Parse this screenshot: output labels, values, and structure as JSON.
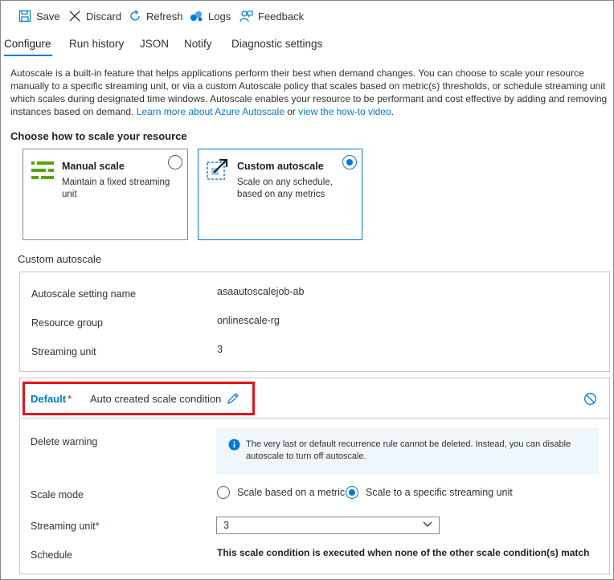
{
  "toolbar": {
    "save": "Save",
    "discard": "Discard",
    "refresh": "Refresh",
    "logs": "Logs",
    "feedback": "Feedback"
  },
  "tabs": [
    {
      "label": "Configure",
      "active": true
    },
    {
      "label": "Run history",
      "active": false
    },
    {
      "label": "JSON",
      "active": false
    },
    {
      "label": "Notify",
      "active": false
    },
    {
      "label": "Diagnostic settings",
      "active": false
    }
  ],
  "intro": {
    "text": "Autoscale is a built-in feature that helps applications perform their best when demand changes. You can choose to scale your resource manually to a specific streaming unit, or via a custom Autoscale policy that scales based on metric(s) thresholds, or schedule streaming unit which scales during designated time windows. Autoscale enables your resource to be performant and cost effective by adding and removing instances based on demand. ",
    "link1": "Learn more about Azure Autoscale",
    "or": " or ",
    "link2": "view the how-to video",
    "end": "."
  },
  "scale_choice": {
    "heading": "Choose how to scale your resource",
    "manual": {
      "title": "Manual scale",
      "desc": "Maintain a fixed streaming unit",
      "selected": false
    },
    "custom": {
      "title": "Custom autoscale",
      "desc": "Scale on any schedule, based on any metrics",
      "selected": true
    }
  },
  "custom_autoscale": {
    "label": "Custom autoscale",
    "setting_name_label": "Autoscale setting name",
    "setting_name_value": "asaautoscalejob-ab",
    "resource_group_label": "Resource group",
    "resource_group_value": "onlinescale-rg",
    "streaming_unit_label": "Streaming unit",
    "streaming_unit_value": "3"
  },
  "condition": {
    "name": "Default",
    "required_mark": "*",
    "description": "Auto created scale condition",
    "delete_warning_label": "Delete warning",
    "delete_warning_text": "The very last or default recurrence rule cannot be deleted. Instead, you can disable autoscale to turn off autoscale.",
    "scale_mode_label": "Scale mode",
    "scale_mode_options": [
      {
        "label": "Scale based on a metric",
        "selected": false
      },
      {
        "label": "Scale to a specific streaming unit",
        "selected": true
      }
    ],
    "streaming_unit_label": "Streaming unit",
    "streaming_unit_required": "*",
    "streaming_unit_value": "3",
    "schedule_label": "Schedule",
    "schedule_text": "This scale condition is executed when none of the other scale condition(s) match"
  },
  "colors": {
    "accent": "#0078d4",
    "highlight": "#e3141b",
    "manual_icon": "#57a300",
    "info_bg": "#eff6fc"
  }
}
